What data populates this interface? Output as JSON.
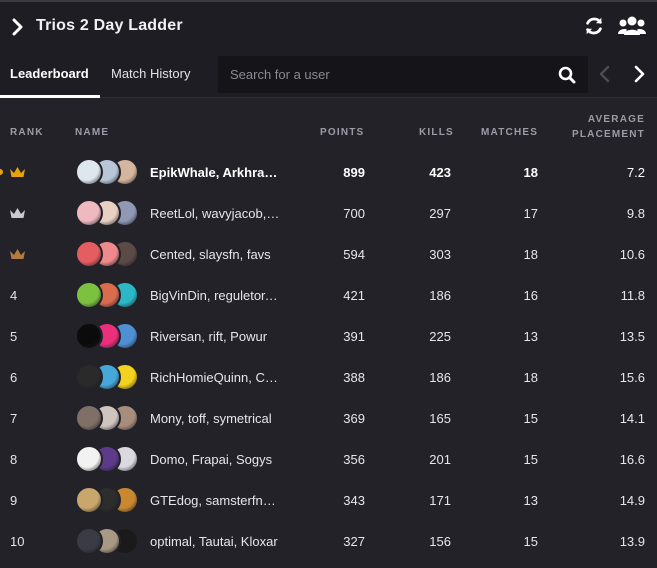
{
  "header": {
    "title": "Trios 2 Day Ladder",
    "back_icon": "chevron-right-icon",
    "refresh_icon": "refresh-icon",
    "group_icon": "group-icon"
  },
  "tabs": [
    {
      "label": "Leaderboard",
      "active": true
    },
    {
      "label": "Match History",
      "active": false
    }
  ],
  "search": {
    "placeholder": "Search for a user",
    "value": ""
  },
  "columns": {
    "rank": "RANK",
    "name": "NAME",
    "points": "POINTS",
    "kills": "KILLS",
    "matches": "MATCHES",
    "avg_line1": "AVERAGE",
    "avg_line2": "PLACEMENT"
  },
  "colors": {
    "gold": "#e8a20c",
    "silver": "#c9c9d0",
    "bronze": "#b57a44",
    "background": "#232229",
    "header_bg": "#1e1d23"
  },
  "rows": [
    {
      "rank": "",
      "crown": "gold",
      "names": "EpikWhale, Arkhram, Mero",
      "points": "899",
      "kills": "423",
      "matches": "18",
      "avg": "7.2",
      "avatar_colors": [
        "#dfe7ee",
        "#b8c7d8",
        "#d6b59e"
      ]
    },
    {
      "rank": "",
      "crown": "silver",
      "names": "ReetLol, wavyjacob, Bizzle",
      "points": "700",
      "kills": "297",
      "matches": "17",
      "avg": "9.8",
      "avatar_colors": [
        "#f0b9bf",
        "#e8d1c2",
        "#8f98b5"
      ]
    },
    {
      "rank": "",
      "crown": "bronze",
      "names": "Cented, slaysfn, favs",
      "points": "594",
      "kills": "303",
      "matches": "18",
      "avg": "10.6",
      "avatar_colors": [
        "#e35d61",
        "#ef8a8c",
        "#5b4a46"
      ]
    },
    {
      "rank": "4",
      "crown": "",
      "names": "BigVinDin, reguletor, Xeno",
      "points": "421",
      "kills": "186",
      "matches": "16",
      "avg": "11.8",
      "avatar_colors": [
        "#7cc140",
        "#d96c4d",
        "#2bb7c6"
      ]
    },
    {
      "rank": "5",
      "crown": "",
      "names": "Riversan, rift, Powur",
      "points": "391",
      "kills": "225",
      "matches": "13",
      "avg": "13.5",
      "avatar_colors": [
        "#0b0b0b",
        "#ec2f7d",
        "#4f8fd4"
      ]
    },
    {
      "rank": "6",
      "crown": "",
      "names": "RichHomieQuinn, Chap, Vivid",
      "points": "388",
      "kills": "186",
      "matches": "18",
      "avg": "15.6",
      "avatar_colors": [
        "#2a2a2a",
        "#46a8d8",
        "#f2d21e"
      ]
    },
    {
      "rank": "7",
      "crown": "",
      "names": "Mony, toff, symetrical",
      "points": "369",
      "kills": "165",
      "matches": "15",
      "avg": "14.1",
      "avatar_colors": [
        "#7f6f66",
        "#cfc5be",
        "#a88d7d"
      ]
    },
    {
      "rank": "8",
      "crown": "",
      "names": "Domo, Frapai, Sogys",
      "points": "356",
      "kills": "201",
      "matches": "15",
      "avg": "16.6",
      "avatar_colors": [
        "#f2f2f2",
        "#5d3a8a",
        "#d9d9df"
      ]
    },
    {
      "rank": "9",
      "crown": "",
      "names": "GTEdog, samsterfn_, Hysteria",
      "points": "343",
      "kills": "171",
      "matches": "13",
      "avg": "14.9",
      "avatar_colors": [
        "#c9a66b",
        "#2d2d2d",
        "#c98830"
      ]
    },
    {
      "rank": "10",
      "crown": "",
      "names": "optimal, Tautai, Kloxar",
      "points": "327",
      "kills": "156",
      "matches": "15",
      "avg": "13.9",
      "avatar_colors": [
        "#3b3b45",
        "#a89984",
        "#1a1a1a"
      ]
    }
  ]
}
